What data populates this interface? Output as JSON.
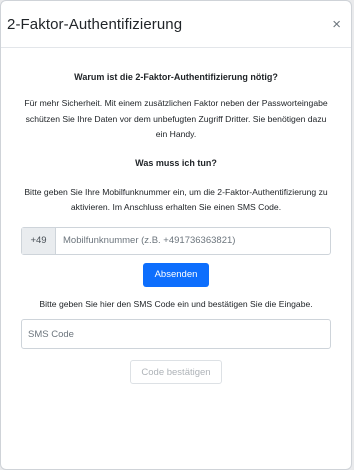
{
  "modal": {
    "title": "2-Faktor-Authentifizierung",
    "close_symbol": "×"
  },
  "why": {
    "heading": "Warum ist die 2-Faktor-Authentifizierung nötig?",
    "text": "Für mehr Sicherheit. Mit einem zusätzlichen Faktor neben der Passworteingabe schützen Sie Ihre Daten vor dem unbefugten Zugriff Dritter. Sie benötigen dazu ein Handy."
  },
  "what": {
    "heading": "Was muss ich tun?",
    "text": "Bitte geben Sie Ihre Mobilfunknummer ein, um die 2-Faktor-Authentifizierung zu aktivieren. Im Anschluss erhalten Sie einen SMS Code."
  },
  "phone": {
    "prefix": "+49",
    "placeholder": "Mobilfunknummer (z.B. +491736363821)",
    "value": ""
  },
  "send_button": "Absenden",
  "sms": {
    "instruction": "Bitte geben Sie hier den SMS Code ein und bestätigen Sie die Eingabe.",
    "placeholder": "SMS Code",
    "value": ""
  },
  "confirm_button": "Code bestätigen",
  "colors": {
    "primary": "#0d6efd",
    "disabled_text": "#aeb3b8"
  }
}
